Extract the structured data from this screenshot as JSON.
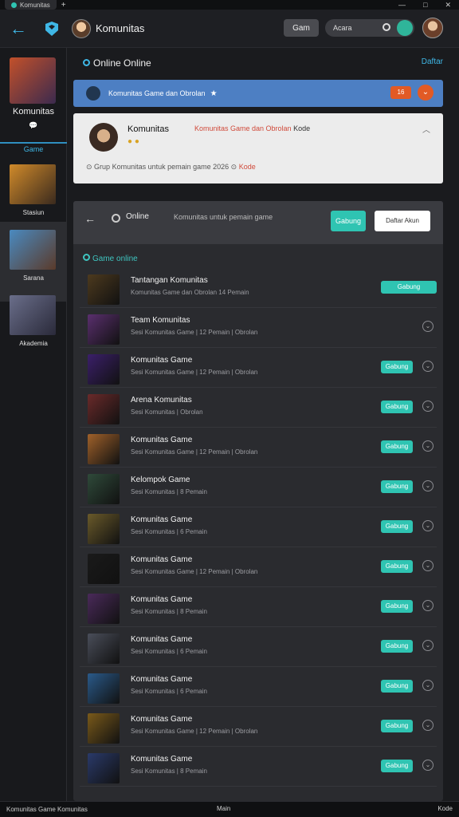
{
  "window": {
    "tab_title": "Komunitas"
  },
  "topbar": {
    "app_title": "Komunitas",
    "button_label": "Gam",
    "search_text": "Acara"
  },
  "sidebar": {
    "profile_name": "Komunitas",
    "section_label": "Game",
    "items": [
      {
        "label": "Stasiun",
        "thumb_color": "#7b5c2a"
      },
      {
        "label": "Sarana",
        "thumb_color": "#3a6d96"
      },
      {
        "label": "Akademia",
        "thumb_color": "#3b3e5a"
      }
    ]
  },
  "main": {
    "header_title": "Online Online",
    "header_link": "Daftar",
    "banner_text": "Komunitas Game dan Obrolan",
    "banner_badge": "16",
    "profile": {
      "name": "Komunitas",
      "description": "Komunitas Game dan Obrolan",
      "highlight": "Kode",
      "footer_left": "Grup",
      "footer_middle": "Komunitas untuk pemain game 2026",
      "footer_right": "Kode"
    },
    "panel": {
      "title": "Online",
      "subtitle": "Komunitas untuk pemain game",
      "primary_button": "Gabung",
      "secondary_button": "Daftar Akun",
      "section_title": "Game online"
    },
    "rows": [
      {
        "name": "Tantangan Komunitas",
        "sub": "Komunitas Game dan Obrolan 14 Pemain",
        "button": "Gabung",
        "color": "#4d3a1e"
      },
      {
        "name": "Team Komunitas",
        "sub": "Sesi Komunitas Game | 12 Pemain | Obrolan",
        "button": "",
        "color": "#5a2f6e"
      },
      {
        "name": "Komunitas Game",
        "sub": "Sesi Komunitas Game | 12 Pemain | Obrolan",
        "button": "Gabung",
        "color": "#3b1f6a"
      },
      {
        "name": "Arena Komunitas",
        "sub": "Sesi Komunitas | Obrolan",
        "button": "Gabung",
        "color": "#6a2a2a"
      },
      {
        "name": "Komunitas Game",
        "sub": "Sesi Komunitas Game | 12 Pemain | Obrolan",
        "button": "Gabung",
        "color": "#a0612a"
      },
      {
        "name": "Kelompok Game",
        "sub": "Sesi Komunitas | 8 Pemain",
        "button": "Gabung",
        "color": "#2f4a3a"
      },
      {
        "name": "Komunitas Game",
        "sub": "Sesi Komunitas | 6 Pemain",
        "button": "Gabung",
        "color": "#6a5a2a"
      },
      {
        "name": "Komunitas Game",
        "sub": "Sesi Komunitas Game | 12 Pemain | Obrolan",
        "button": "Gabung",
        "color": "#1a1a1a"
      },
      {
        "name": "Komunitas Game",
        "sub": "Sesi Komunitas | 8 Pemain",
        "button": "Gabung",
        "color": "#4a2a5a"
      },
      {
        "name": "Komunitas Game",
        "sub": "Sesi Komunitas | 6 Pemain",
        "button": "Gabung",
        "color": "#4a4e5a"
      },
      {
        "name": "Komunitas Game",
        "sub": "Sesi Komunitas | 6 Pemain",
        "button": "Gabung",
        "color": "#2a5a8a"
      },
      {
        "name": "Komunitas Game",
        "sub": "Sesi Komunitas Game | 12 Pemain | Obrolan",
        "button": "Gabung",
        "color": "#7a5a1a"
      },
      {
        "name": "Komunitas Game",
        "sub": "Sesi Komunitas | 8 Pemain",
        "button": "Gabung",
        "color": "#2a3a6a"
      }
    ]
  },
  "statusbar": {
    "left": "Komunitas Game Komunitas",
    "center": "Main",
    "right": "Kode"
  }
}
